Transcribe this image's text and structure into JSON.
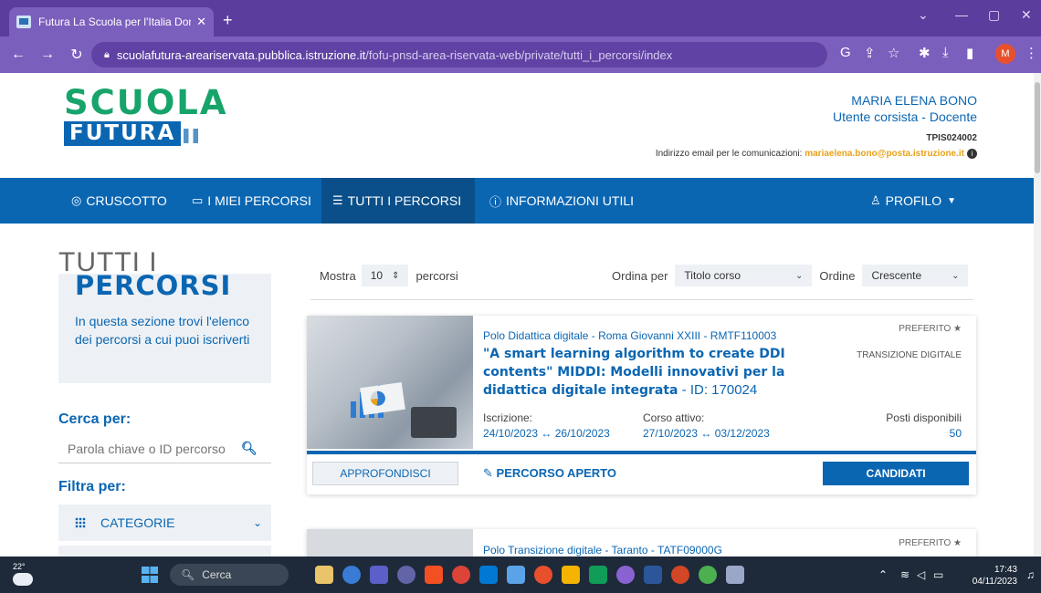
{
  "browser": {
    "tab_title": "Futura La Scuola per l'Italia Dom",
    "url_host": "scuolafutura-areariservata.pubblica.istruzione.it",
    "url_path": "/fofu-pnsd-area-riservata-web/private/tutti_i_percorsi/index",
    "avatar_letter": "M"
  },
  "header": {
    "logo_top": "SCUOLA",
    "logo_bottom": "FUTURA",
    "user_name": "MARIA ELENA BONO",
    "user_role": "Utente corsista - Docente",
    "school_code": "TPIS024002",
    "email_label": "Indirizzo email per le comunicazioni:",
    "email": "mariaelena.bono@posta.istruzione.it"
  },
  "nav": {
    "items": [
      {
        "label": "CRUSCOTTO",
        "icon": "target-icon"
      },
      {
        "label": "I MIEI PERCORSI",
        "icon": "monitor-icon"
      },
      {
        "label": "TUTTI I PERCORSI",
        "icon": "list-icon"
      },
      {
        "label": "INFORMAZIONI UTILI",
        "icon": "question-icon"
      }
    ],
    "profile": "PROFILO"
  },
  "sidebar": {
    "title_line1": "TUTTI I",
    "title_line2": "PERCORSI",
    "description": "In questa sezione trovi l'elenco dei percorsi a cui puoi iscriverti",
    "search_title": "Cerca per:",
    "search_placeholder": "Parola chiave o ID percorso",
    "filter_title": "Filtra per:",
    "category_label": "CATEGORIE"
  },
  "controls": {
    "show_label": "Mostra",
    "show_value": "10",
    "show_suffix": "percorsi",
    "order_by_label": "Ordina per",
    "order_by_value": "Titolo corso",
    "order_label": "Ordine",
    "order_value": "Crescente"
  },
  "courses": [
    {
      "polo": "Polo Didattica digitale - Roma Giovanni XXIII - RMTF110003",
      "title": "\"A smart learning algorithm to create DDI contents\" MIDDI: Modelli innovativi per la didattica digitale integrata",
      "id_text": "- ID: 170024",
      "favorite": "PREFERITO",
      "tag": "TRANSIZIONE DIGITALE",
      "enroll_label": "Iscrizione:",
      "enroll_value": "24/10/2023 ↔ 26/10/2023",
      "active_label": "Corso attivo:",
      "active_value": "27/10/2023 ↔ 03/12/2023",
      "seats_label": "Posti disponibili",
      "seats_value": "50",
      "more_button": "APPROFONDISCI",
      "status": "PERCORSO APERTO",
      "apply_button": "CANDIDATI"
    },
    {
      "polo": "Polo Transizione digitale - Taranto - TATF09000G",
      "favorite": "PREFERITO"
    }
  ],
  "taskbar": {
    "temperature": "22°",
    "search": "Cerca",
    "time": "17:43",
    "date": "04/11/2023"
  }
}
